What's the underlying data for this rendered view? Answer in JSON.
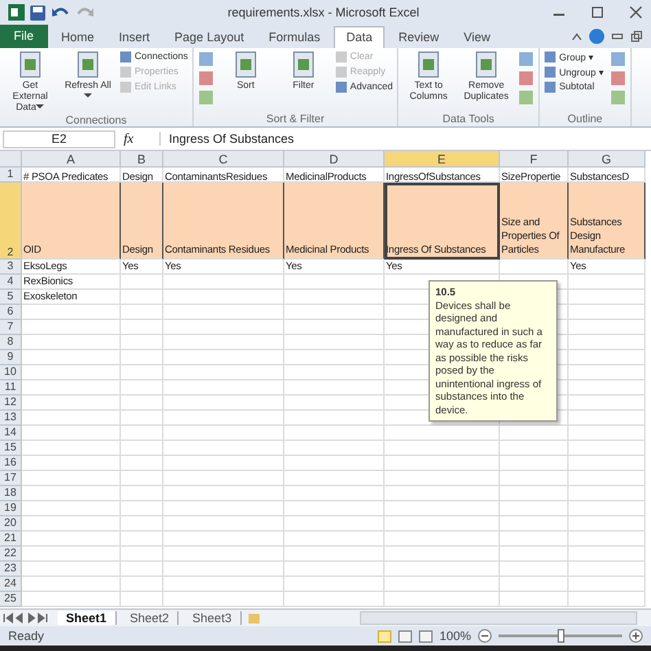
{
  "window": {
    "title": "requirements.xlsx - Microsoft Excel"
  },
  "tabs": [
    {
      "label": "File",
      "kind": "file",
      "selected": false
    },
    {
      "label": "Home",
      "kind": "tab",
      "selected": false
    },
    {
      "label": "Insert",
      "kind": "tab",
      "selected": false
    },
    {
      "label": "Page Layout",
      "kind": "tab",
      "selected": false
    },
    {
      "label": "Formulas",
      "kind": "tab",
      "selected": false
    },
    {
      "label": "Data",
      "kind": "tab",
      "selected": true
    },
    {
      "label": "Review",
      "kind": "tab",
      "selected": false
    },
    {
      "label": "View",
      "kind": "tab",
      "selected": false
    }
  ],
  "ribbon_groups": [
    {
      "label": "Connections",
      "items": [
        {
          "kind": "large",
          "label": "Get External Data",
          "dropdown": true,
          "disabled": false
        },
        {
          "kind": "large",
          "label": "Refresh All",
          "dropdown": true,
          "disabled": false
        },
        {
          "kind": "stack",
          "items": [
            {
              "label": "Connections",
              "disabled": false
            },
            {
              "label": "Properties",
              "disabled": true
            },
            {
              "label": "Edit Links",
              "disabled": true
            }
          ]
        }
      ]
    },
    {
      "label": "Sort & Filter",
      "items": [
        {
          "kind": "icons"
        },
        {
          "kind": "large",
          "label": "Sort",
          "dropdown": false,
          "disabled": false
        },
        {
          "kind": "large",
          "label": "Filter",
          "dropdown": false,
          "disabled": false
        },
        {
          "kind": "stack",
          "items": [
            {
              "label": "Clear",
              "disabled": true
            },
            {
              "label": "Reapply",
              "disabled": true
            },
            {
              "label": "Advanced",
              "disabled": false
            }
          ]
        }
      ]
    },
    {
      "label": "Data Tools",
      "items": [
        {
          "kind": "large",
          "label": "Text to Columns",
          "dropdown": false,
          "disabled": false
        },
        {
          "kind": "large",
          "label": "Remove Duplicates",
          "dropdown": false,
          "disabled": false
        },
        {
          "kind": "icons"
        }
      ]
    },
    {
      "label": "Outline",
      "items": [
        {
          "kind": "stack",
          "items": [
            {
              "label": "Group ▾",
              "disabled": false
            },
            {
              "label": "Ungroup ▾",
              "disabled": false
            },
            {
              "label": "Subtotal",
              "disabled": false
            }
          ]
        },
        {
          "kind": "icons"
        }
      ]
    }
  ],
  "formula_bar": {
    "name_box": "E2",
    "fx": "fx",
    "value": "Ingress Of Substances"
  },
  "columns": [
    {
      "label": "A",
      "selected": false
    },
    {
      "label": "B",
      "selected": false
    },
    {
      "label": "C",
      "selected": false
    },
    {
      "label": "D",
      "selected": false
    },
    {
      "label": "E",
      "selected": true
    },
    {
      "label": "F",
      "selected": false
    },
    {
      "label": "G",
      "selected": false
    }
  ],
  "rows": [
    {
      "number": "1",
      "kind": "plain",
      "selected": false,
      "cells": [
        "# PSOA Predicates",
        "Design",
        "ContaminantsResidues",
        "MedicinalProducts",
        "IngressOfSubstances",
        "SizePropertie",
        "SubstancesD"
      ]
    },
    {
      "number": "2",
      "kind": "header",
      "selected": true,
      "cells": [
        "OID",
        "Design",
        "Contaminants Residues",
        "Medicinal Products",
        "Ingress Of Substances",
        "Size and Properties Of Particles",
        "Substances Design Manufacture"
      ]
    },
    {
      "number": "3",
      "kind": "plain",
      "selected": false,
      "cells": [
        "EksoLegs",
        "Yes",
        "Yes",
        "Yes",
        "Yes",
        "",
        "Yes"
      ]
    },
    {
      "number": "4",
      "kind": "plain",
      "selected": false,
      "cells": [
        "RexBionics",
        "",
        "",
        "",
        "",
        "",
        ""
      ]
    },
    {
      "number": "5",
      "kind": "plain",
      "selected": false,
      "cells": [
        "Exoskeleton",
        "",
        "",
        "",
        "",
        "",
        ""
      ]
    },
    {
      "number": "6",
      "kind": "plain",
      "selected": false,
      "cells": [
        "",
        "",
        "",
        "",
        "",
        "",
        ""
      ]
    },
    {
      "number": "7",
      "kind": "plain",
      "selected": false,
      "cells": [
        "",
        "",
        "",
        "",
        "",
        "",
        ""
      ]
    },
    {
      "number": "8",
      "kind": "plain",
      "selected": false,
      "cells": [
        "",
        "",
        "",
        "",
        "",
        "",
        ""
      ]
    },
    {
      "number": "9",
      "kind": "plain",
      "selected": false,
      "cells": [
        "",
        "",
        "",
        "",
        "",
        "",
        ""
      ]
    },
    {
      "number": "10",
      "kind": "plain",
      "selected": false,
      "cells": [
        "",
        "",
        "",
        "",
        "",
        "",
        ""
      ]
    },
    {
      "number": "11",
      "kind": "plain",
      "selected": false,
      "cells": [
        "",
        "",
        "",
        "",
        "",
        "",
        ""
      ]
    },
    {
      "number": "12",
      "kind": "plain",
      "selected": false,
      "cells": [
        "",
        "",
        "",
        "",
        "",
        "",
        ""
      ]
    },
    {
      "number": "13",
      "kind": "plain",
      "selected": false,
      "cells": [
        "",
        "",
        "",
        "",
        "",
        "",
        ""
      ]
    },
    {
      "number": "14",
      "kind": "plain",
      "selected": false,
      "cells": [
        "",
        "",
        "",
        "",
        "",
        "",
        ""
      ]
    },
    {
      "number": "15",
      "kind": "plain",
      "selected": false,
      "cells": [
        "",
        "",
        "",
        "",
        "",
        "",
        ""
      ]
    },
    {
      "number": "16",
      "kind": "plain",
      "selected": false,
      "cells": [
        "",
        "",
        "",
        "",
        "",
        "",
        ""
      ]
    },
    {
      "number": "17",
      "kind": "plain",
      "selected": false,
      "cells": [
        "",
        "",
        "",
        "",
        "",
        "",
        ""
      ]
    },
    {
      "number": "18",
      "kind": "plain",
      "selected": false,
      "cells": [
        "",
        "",
        "",
        "",
        "",
        "",
        ""
      ]
    },
    {
      "number": "19",
      "kind": "plain",
      "selected": false,
      "cells": [
        "",
        "",
        "",
        "",
        "",
        "",
        ""
      ]
    },
    {
      "number": "20",
      "kind": "plain",
      "selected": false,
      "cells": [
        "",
        "",
        "",
        "",
        "",
        "",
        ""
      ]
    },
    {
      "number": "21",
      "kind": "plain",
      "selected": false,
      "cells": [
        "",
        "",
        "",
        "",
        "",
        "",
        ""
      ]
    },
    {
      "number": "22",
      "kind": "plain",
      "selected": false,
      "cells": [
        "",
        "",
        "",
        "",
        "",
        "",
        ""
      ]
    },
    {
      "number": "23",
      "kind": "plain",
      "selected": false,
      "cells": [
        "",
        "",
        "",
        "",
        "",
        "",
        ""
      ]
    },
    {
      "number": "24",
      "kind": "plain",
      "selected": false,
      "cells": [
        "",
        "",
        "",
        "",
        "",
        "",
        ""
      ]
    },
    {
      "number": "25",
      "kind": "plain",
      "selected": false,
      "cells": [
        "",
        "",
        "",
        "",
        "",
        "",
        ""
      ]
    }
  ],
  "comment": {
    "title": "10.5",
    "text": "Devices shall be designed and manufactured in such a way as to reduce as far as possible the risks posed by the unintentional ingress of substances into the device."
  },
  "sheet_tabs": [
    {
      "label": "Sheet1",
      "selected": true
    },
    {
      "label": "Sheet2",
      "selected": false
    },
    {
      "label": "Sheet3",
      "selected": false
    }
  ],
  "status_bar": {
    "status": "Ready",
    "views": [
      {
        "selected": true
      },
      {
        "selected": false
      },
      {
        "selected": false
      }
    ],
    "zoom": "100%",
    "zoom_slider": {
      "level": 0.5
    }
  }
}
